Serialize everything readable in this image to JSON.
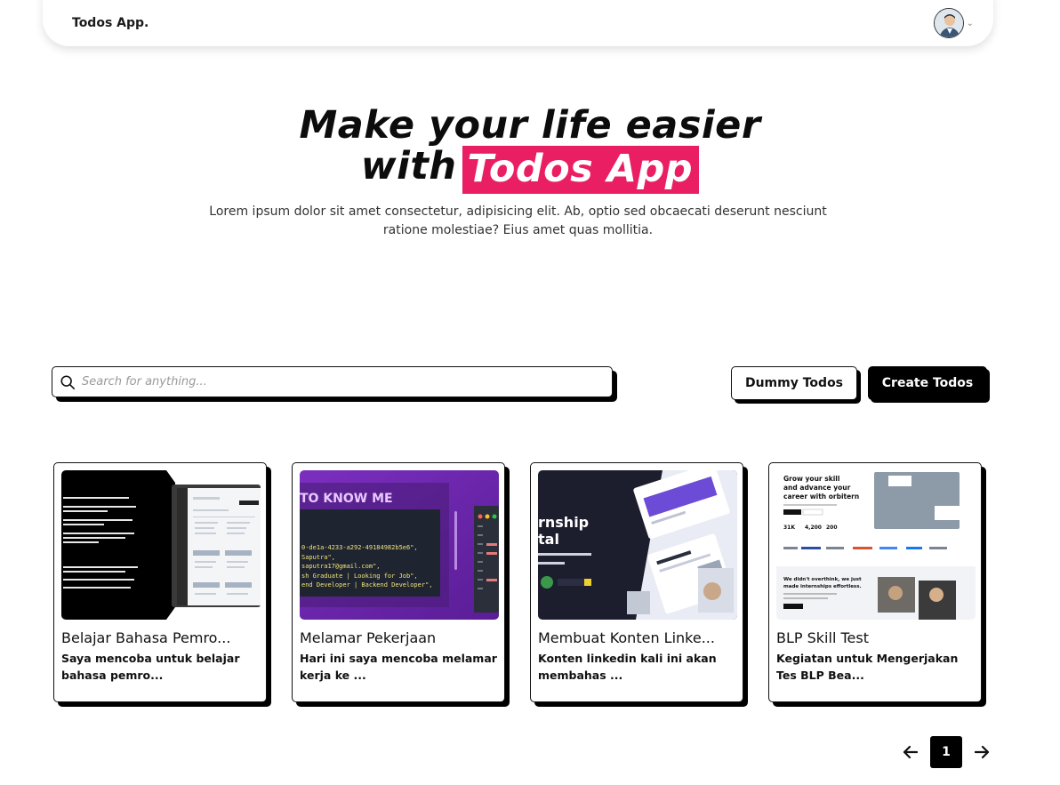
{
  "navbar": {
    "brand": "Todos App.",
    "avatar_icon": "user-avatar",
    "dropdown_icon": "chevron-down-icon"
  },
  "hero": {
    "title_line1": "Make your life easier",
    "title_line2_prefix": "with",
    "title_highlight": "Todos App",
    "subtitle": "Lorem ipsum dolor sit amet consectetur, adipisicing elit. Ab, optio sed obcaecati deserunt nesciunt ratione molestiae? Eius amet quas mollitia.",
    "highlight_color": "#e91e63"
  },
  "search": {
    "placeholder": "Search for anything...",
    "value": "",
    "icon": "search-icon"
  },
  "actions": {
    "dummy_label": "Dummy Todos",
    "create_label": "Create Todos"
  },
  "cards": [
    {
      "title": "Belajar Bahasa Pemro...",
      "description": "Saya mencoba untuk belajar bahasa pemro..."
    },
    {
      "title": "Melamar Pekerjaan",
      "description": "Hari ini saya mencoba melamar kerja ke ...",
      "thumb_text": "TO KNOW ME"
    },
    {
      "title": "Membuat Konten Linke...",
      "description": "Konten linkedin kali ini akan membahas ...",
      "thumb_text_1": "rnship",
      "thumb_text_2": "tal"
    },
    {
      "title": "BLP Skill Test",
      "description": "Kegiatan untuk Mengerjakan Tes BLP Bea...",
      "thumb_text_1": "Grow your skill",
      "thumb_text_2": "and advance your",
      "thumb_text_3": "career with orbitern"
    }
  ],
  "pagination": {
    "current_page": "1",
    "prev_icon": "arrow-left-icon",
    "next_icon": "arrow-right-icon"
  }
}
